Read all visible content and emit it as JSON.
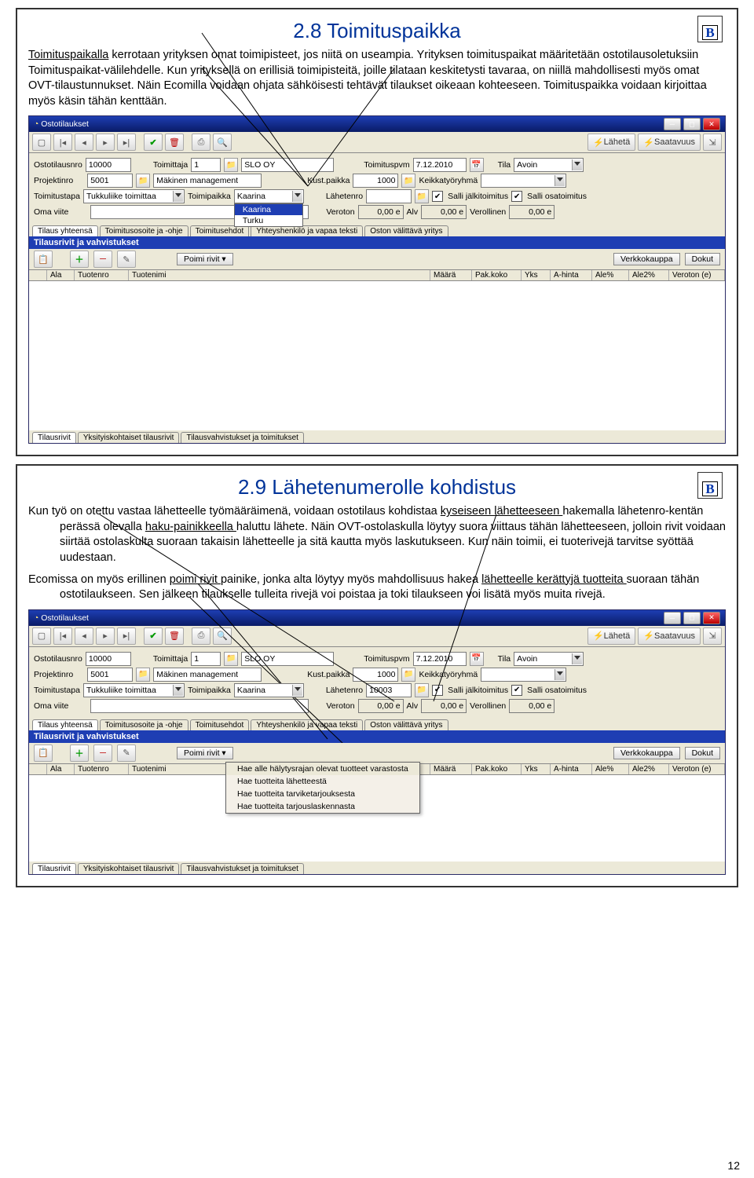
{
  "page_number": "12",
  "sec1": {
    "title": "2.8 Toimituspaikka",
    "para1a": "Toimituspaikalla",
    "para1b": " kerrotaan yrityksen omat toimipisteet, jos niitä on useampia. Yrityksen toimituspaikat määritetään ostotilausoletuksiin Toimituspaikat-välilehdelle. Kun yrityksellä on erillisiä toimipisteitä, joille tilataan keskitetysti tavaraa, on niillä mahdollisesti myös omat OVT-tilaustunnukset. Näin Ecomilla voidaan ohjata sähköisesti tehtävät tilaukset oikeaan kohteeseen. Toimituspaikka voidaan kirjoittaa myös käsin tähän kenttään.",
    "dropdown": [
      "Kaarina",
      "Turku"
    ]
  },
  "sec2": {
    "title": "2.9 Lähetenumerolle kohdistus",
    "para1": "Kun työ on otettu vastaa lähetteelle työmääräimenä, voidaan ostotilaus kohdistaa ",
    "para1_u1": "kyseiseen lähetteeseen ",
    "para1_mid": "hakemalla lähetenro-kentän perässä olevalla ",
    "para1_u2": "haku-painikkeella ",
    "para1_end": "haluttu lähete. Näin OVT-ostolaskulla löytyy suora viittaus tähän lähetteeseen, jolloin rivit voidaan siirtää ostolaskulta suoraan takaisin lähetteelle ja sitä kautta myös laskutukseen. Kun näin toimii, ei tuoterivejä tarvitse syöttää uudestaan.",
    "para2a": "Ecomissa on myös erillinen ",
    "para2_u": "poimi rivit ",
    "para2b": "painike,  jonka alta löytyy myös mahdollisuus hakea ",
    "para2_u2": "lähetteelle kerättyjä tuotteita ",
    "para2c": "suoraan tähän ostotilaukseen. Sen jälkeen tilaukselle tulleita rivejä voi poistaa ja toki tilaukseen voi lisätä myös muita rivejä.",
    "menu": [
      "Hae alle hälytysrajan olevat tuotteet varastosta",
      "Hae tuotteita lähetteestä",
      "Hae tuotteita tarviketarjouksesta",
      "Hae tuotteita tarjouslaskennasta"
    ],
    "lahete": "10003"
  },
  "app": {
    "title": "Ostotilaukset",
    "laheta": "Lähetä",
    "saatavuus": "Saatavuus",
    "fields": {
      "ostotilausnro_lbl": "Ostotilausnro",
      "ostotilausnro": "10000",
      "toimittaja_lbl": "Toimittaja",
      "toimittaja_no": "1",
      "toimittaja_name": "SLO OY",
      "toimituspvm_lbl": "Toimituspvm",
      "toimituspvm": "7.12.2010",
      "tila_lbl": "Tila",
      "tila": "Avoin",
      "projektinro_lbl": "Projektinro",
      "projektinro": "5001",
      "projektinimi": "Mäkinen management",
      "kustpaikka_lbl": "Kust.paikka",
      "kustpaikka": "1000",
      "keikkatyoryhma_lbl": "Keikkatyöryhmä",
      "toimitustapa_lbl": "Toimitustapa",
      "toimitustapa": "Tukkuliike toimittaa",
      "toimipaikka_lbl": "Toimipaikka",
      "toimipaikka": "Kaarina",
      "lahetenro_lbl": "Lähetenro",
      "salli_jalki": "Salli jälkitoimitus",
      "salli_osa": "Salli osatoimitus",
      "omaviite_lbl": "Oma viite",
      "veroton_lbl": "Veroton",
      "veroton": "0,00 e",
      "alv_lbl": "Alv",
      "alv": "0,00 e",
      "verollinen_lbl": "Verollinen",
      "verollinen": "0,00 e"
    },
    "tabs_top": [
      "Tilaus yhteensä",
      "Toimitusosoite ja -ohje",
      "Toimitusehdot",
      "Yhteyshenkilö ja vapaa teksti",
      "Oston välittävä yritys"
    ],
    "bluebar": "Tilausrivit ja vahvistukset",
    "poimi": "Poimi rivit",
    "verkkokauppa": "Verkkokauppa",
    "dokut": "Dokut",
    "grid_cols": [
      "",
      "Ala",
      "Tuotenro",
      "Tuotenimi",
      "Määrä",
      "Pak.koko",
      "Yks",
      "A-hinta",
      "Ale%",
      "Ale2%",
      "Veroton (e)"
    ],
    "tabs_bottom": [
      "Tilausrivit",
      "Yksityiskohtaiset tilausrivit",
      "Tilausvahvistukset ja toimitukset"
    ]
  }
}
